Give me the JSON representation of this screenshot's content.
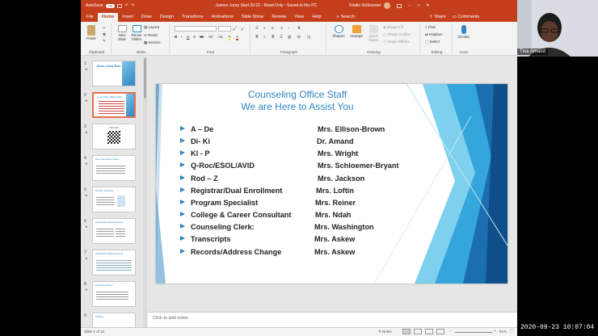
{
  "titlebar": {
    "autosave": "AutoSave",
    "autosave_state": "Off",
    "doc_title": "Juniors Jump Start 20-21  -  Read-Only  -  Saved to this PC",
    "user": "Kindin Schloemer"
  },
  "search": {
    "label": "Search"
  },
  "tabs": [
    "File",
    "Home",
    "Insert",
    "Draw",
    "Design",
    "Transitions",
    "Animations",
    "Slide Show",
    "Review",
    "View",
    "Help"
  ],
  "share": {
    "share_label": "Share",
    "comments_label": "Comments"
  },
  "ribbon": {
    "clipboard": {
      "paste": "Paste",
      "label": "Clipboard"
    },
    "slides": {
      "new_slide": "New Slide",
      "reuse_slides": "Reuse Slides",
      "layout": "Layout",
      "reset": "Reset",
      "section": "Section",
      "label": "Slides"
    },
    "font": {
      "label": "Font"
    },
    "paragraph": {
      "label": "Paragraph"
    },
    "drawing": {
      "shapes": "Shapes",
      "arrange": "Arrange",
      "quick_styles": "Quick Styles",
      "shape_fill": "Shape Fill",
      "shape_outline": "Shape Outline",
      "shape_effects": "Shape Effects",
      "label": "Drawing"
    },
    "editing": {
      "find": "Find",
      "replace": "Replace",
      "select": "Select",
      "label": "Editing"
    },
    "voice": {
      "dictate": "Dictate",
      "label": "Voice"
    }
  },
  "thumbnails": [
    {
      "num": "1",
      "caption": "Junior Jump Start"
    },
    {
      "num": "2",
      "caption": "Counseling Office Staff"
    },
    {
      "num": "3",
      "caption": "Flip Grid"
    },
    {
      "num": "4",
      "caption": "Post Secondary Plans"
    },
    {
      "num": "5",
      "caption": "Course Selection"
    },
    {
      "num": "6",
      "caption": "Graduation Requirements"
    },
    {
      "num": "7",
      "caption": "Graduation Requirements"
    },
    {
      "num": "8",
      "caption": "Important Dates"
    },
    {
      "num": "9",
      "caption": "Testing"
    }
  ],
  "slide": {
    "title_line1": "Counseling Office Staff",
    "title_line2": "We are Here to Assist You",
    "rows": [
      {
        "label": "A – De",
        "name": "Mrs. Ellison-Brown"
      },
      {
        "label": "Di- Ki",
        "name": "Dr. Amand"
      },
      {
        "label": "Kl - P",
        "name": "Mrs. Wright"
      },
      {
        "label": "Q-Roc/ESOL/AVID",
        "name": "Mrs. Schloemer-Bryant"
      },
      {
        "label": "Rod – Z",
        "name": "Mrs. Jackson"
      },
      {
        "label": "Registrar/Dual Enrollment",
        "name": "Mrs. Loftin"
      },
      {
        "label": "Program Specialist",
        "name": "Mrs. Reiner"
      },
      {
        "label": "College & Career Consultant",
        "name": "Mrs. Ndah"
      },
      {
        "label": "Counseling Clerk:",
        "name": "Mrs. Washington"
      },
      {
        "label": "Transcripts",
        "name": "Mrs. Askew"
      },
      {
        "label": "Records/Address Change",
        "name": "Mrs. Askew"
      }
    ]
  },
  "notes": {
    "placeholder": "Click to add notes"
  },
  "status": {
    "slide_counter": "Slide 2 of 10",
    "notes": "Notes",
    "zoom": "81%"
  },
  "camera": {
    "name": "Tina Amand"
  },
  "timestamp": "2020-09-23 10:07:04",
  "colors": {
    "accent": "#c43e1c",
    "title_blue": "#2e86c1"
  }
}
